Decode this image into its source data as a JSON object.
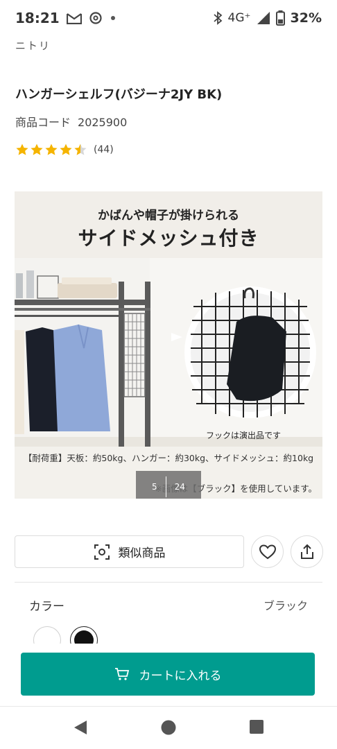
{
  "status_bar": {
    "time": "18:21",
    "network": "4G⁺",
    "battery": "32%",
    "icons": [
      "gmail-icon",
      "threads-icon",
      "notification-dot-icon",
      "bluetooth-icon",
      "signal-icon",
      "battery-icon"
    ]
  },
  "brand": "ニトリ",
  "product": {
    "title": "ハンガーシェルフ(バジーナ2JY BK)",
    "code_label": "商品コード",
    "code_value": "2025900",
    "rating": 4.5,
    "rating_count": "(44)"
  },
  "image": {
    "headline_sub": "かばんや帽子が掛けられる",
    "headline_main": "サイドメッシュ付き",
    "hook_caption": "フックは演出品です",
    "capacity": "【耐荷重】天板：約50kg、ハンガー：約30kg、サイドメッシュ：約10kg",
    "note": "※画像は【ブラック】を使用しています。",
    "pager_current": "5",
    "pager_total": "24"
  },
  "actions": {
    "similar_label": "類似商品",
    "favorite_icon": "heart-icon",
    "share_icon": "share-icon"
  },
  "color": {
    "label": "カラー",
    "selected": "ブラック",
    "options": [
      "white",
      "black"
    ]
  },
  "cart": {
    "label": "カートに入れる"
  },
  "colors": {
    "accent": "#009c8f",
    "star": "#f5b400"
  }
}
